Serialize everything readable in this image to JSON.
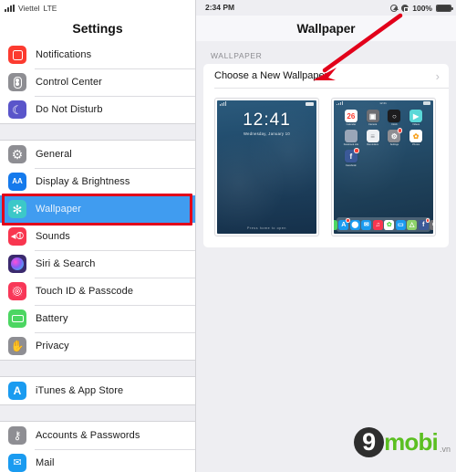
{
  "status_bar": {
    "signal_icon": "cellular-bars-icon",
    "carrier": "Viettel",
    "network": "LTE",
    "time": "2:34 PM",
    "location_icon": "location-services-icon",
    "rotation_lock_icon": "rotation-lock-icon",
    "battery_percent": "100%",
    "battery_icon": "battery-full-icon"
  },
  "sidebar": {
    "title": "Settings",
    "groups": [
      {
        "items": [
          {
            "label": "Notifications",
            "icon": "notifications-icon",
            "color": "#fc3b30"
          },
          {
            "label": "Control Center",
            "icon": "control-center-icon",
            "color": "#8e8e93"
          },
          {
            "label": "Do Not Disturb",
            "icon": "moon-icon",
            "color": "#5a55ca"
          }
        ]
      },
      {
        "items": [
          {
            "label": "General",
            "icon": "gear-icon",
            "color": "#8e8e93"
          },
          {
            "label": "Display & Brightness",
            "icon": "aa-icon",
            "color": "#157aec"
          },
          {
            "label": "Wallpaper",
            "icon": "wallpaper-icon",
            "color": "#3cc8c8",
            "selected": true
          },
          {
            "label": "Sounds",
            "icon": "speaker-icon",
            "color": "#f8364f"
          },
          {
            "label": "Siri & Search",
            "icon": "siri-icon",
            "color": "#3b2a6e"
          },
          {
            "label": "Touch ID & Passcode",
            "icon": "fingerprint-icon",
            "color": "#f83758"
          },
          {
            "label": "Battery",
            "icon": "battery-icon",
            "color": "#4cd662"
          },
          {
            "label": "Privacy",
            "icon": "hand-icon",
            "color": "#8e8e93"
          }
        ]
      },
      {
        "items": [
          {
            "label": "iTunes & App Store",
            "icon": "app-store-icon",
            "color": "#1a9bf0"
          }
        ]
      },
      {
        "items": [
          {
            "label": "Accounts & Passwords",
            "icon": "key-icon",
            "color": "#8e8e93"
          },
          {
            "label": "Mail",
            "icon": "mail-icon",
            "color": "#1a9bf0"
          }
        ]
      }
    ]
  },
  "main": {
    "title": "Wallpaper",
    "section_header": "WALLPAPER",
    "choose_row": {
      "label": "Choose a New Wallpaper",
      "chevron": "chevron-right-icon"
    },
    "previews": {
      "lock_screen": {
        "name": "lock-screen-preview",
        "time": "12:41",
        "date": "Wednesday, January 10",
        "footer": "Press home to open"
      },
      "home_screen": {
        "name": "home-screen-preview",
        "time": "12:41",
        "apps": [
          {
            "label": "Calendar",
            "icon": "calendar-icon",
            "color": "#ffffff",
            "glyph": "26",
            "glyph_color": "#fc3b30",
            "badge": false
          },
          {
            "label": "Camera",
            "icon": "camera-icon",
            "color": "#6e6e73",
            "glyph": "▣",
            "glyph_color": "#ffffff",
            "badge": false
          },
          {
            "label": "Clock",
            "icon": "clock-icon",
            "color": "#1c1c1e",
            "glyph": "○",
            "glyph_color": "#ffffff",
            "badge": false
          },
          {
            "label": "Videos",
            "icon": "videos-icon",
            "color": "#5ad8d8",
            "glyph": "▶",
            "glyph_color": "#ffffff",
            "badge": false
          },
          {
            "label": "Facebook Lite",
            "icon": "folder-icon",
            "color": "#9aa6b8",
            "glyph": "",
            "glyph_color": "#ffffff",
            "badge": false
          },
          {
            "label": "Reminders",
            "icon": "reminders-icon",
            "color": "#eef0f3",
            "glyph": "≡",
            "glyph_color": "#8e8e93",
            "badge": false
          },
          {
            "label": "Settings",
            "icon": "settings-icon",
            "color": "#8e8e93",
            "glyph": "⚙",
            "glyph_color": "#ffffff",
            "badge": true
          },
          {
            "label": "Photos",
            "icon": "photos-icon",
            "color": "#ffffff",
            "glyph": "✿",
            "glyph_color": "#f7a01c",
            "badge": false
          },
          {
            "label": "Facebook",
            "icon": "facebook-icon",
            "color": "#3b5998",
            "glyph": "f",
            "glyph_color": "#ffffff",
            "badge": true
          }
        ],
        "dock": [
          {
            "label": "Messages",
            "icon": "messages-icon",
            "color": "#4cd662",
            "glyph": "●",
            "glyph_color": "#ffffff",
            "badge": false
          },
          {
            "label": "App Store",
            "icon": "app-store-icon",
            "color": "#1a9bf0",
            "glyph": "A",
            "glyph_color": "#ffffff",
            "badge": true
          },
          {
            "label": "Safari",
            "icon": "safari-icon",
            "color": "#1a9bf0",
            "glyph": "⬤",
            "glyph_color": "#ffffff",
            "badge": false
          },
          {
            "label": "Mail",
            "icon": "mail-icon",
            "color": "#1a9bf0",
            "glyph": "✉",
            "glyph_color": "#ffffff",
            "badge": false
          },
          {
            "label": "Music",
            "icon": "music-icon",
            "color": "#f8364f",
            "glyph": "♫",
            "glyph_color": "#ffffff",
            "badge": false
          },
          {
            "label": "Photos",
            "icon": "photos-icon",
            "color": "#ffffff",
            "glyph": "✿",
            "glyph_color": "#5ad84c",
            "badge": false
          },
          {
            "label": "Finder",
            "icon": "files-icon",
            "color": "#1a9bf0",
            "glyph": "▭",
            "glyph_color": "#ffffff",
            "badge": false
          },
          {
            "label": "Maps",
            "icon": "maps-icon",
            "color": "#8ed36a",
            "glyph": "△",
            "glyph_color": "#ffffff",
            "badge": false
          },
          {
            "label": "Facebook",
            "icon": "facebook-icon",
            "color": "#3b5998",
            "glyph": "f",
            "glyph_color": "#ffffff",
            "badge": true
          },
          {
            "label": "Settings",
            "icon": "settings-icon",
            "color": "#6e6e73",
            "glyph": "⚙",
            "glyph_color": "#ffffff",
            "badge": true
          }
        ]
      }
    }
  },
  "annotations": {
    "highlight_box": {
      "name": "red-highlight-box",
      "color": "#e2001a"
    },
    "arrow": {
      "name": "red-pointer-arrow",
      "color": "#e2001a",
      "points_to": "Choose a New Wallpaper"
    }
  },
  "watermark": {
    "mark": "9",
    "text": "mobi",
    "suffix": ".vn",
    "text_color": "#5bbf21"
  }
}
